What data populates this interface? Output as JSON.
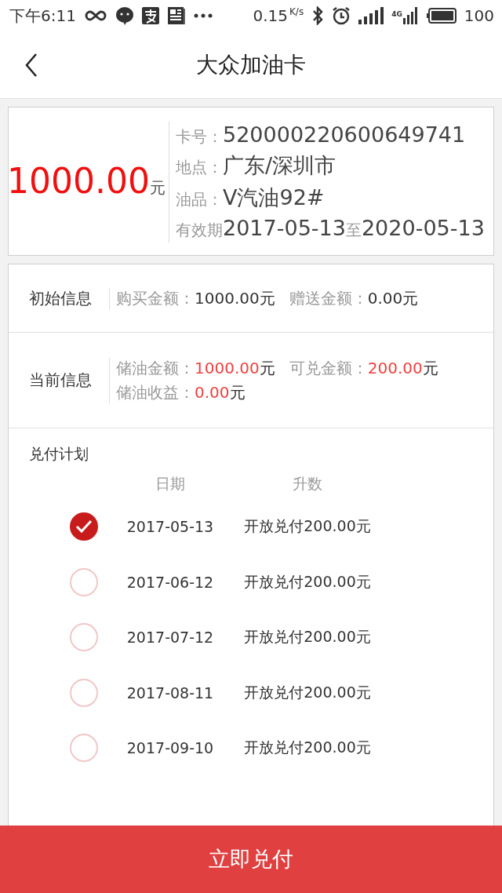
{
  "status_bar": {
    "time": "下午6:11",
    "speed": "0.15",
    "speed_unit": "K/s",
    "network_type": "4G",
    "battery": "100"
  },
  "header": {
    "title": "大众加油卡"
  },
  "card": {
    "amount": "1000.00",
    "unit": "元",
    "details": [
      {
        "label": "卡号：",
        "value": "520000220600649741"
      },
      {
        "label": "地点：",
        "value": "广东/深圳市"
      },
      {
        "label": "油品：",
        "value": "V汽油92#"
      },
      {
        "label": "有效期",
        "value": "2017-05-13",
        "separator": "至",
        "value_end": "2020-05-13"
      }
    ]
  },
  "info_sections": [
    {
      "title": "初始信息",
      "items": [
        {
          "label": "购买金额：",
          "value": "1000.00",
          "unit": "元",
          "highlight": false
        },
        {
          "label": "赠送金额：",
          "value": "0.00",
          "unit": "元",
          "highlight": false
        }
      ]
    },
    {
      "title": "当前信息",
      "items": [
        {
          "label": "储油金额：",
          "value": "1000.00",
          "unit": "元",
          "highlight": true
        },
        {
          "label": "可兑金额：",
          "value": "200.00",
          "unit": "元",
          "highlight": true
        },
        {
          "label": "储油收益：",
          "value": "0.00",
          "unit": "元",
          "highlight": true
        }
      ]
    }
  ],
  "plan": {
    "title": "兑付计划",
    "columns": [
      "日期",
      "升数"
    ],
    "rows": [
      {
        "date": "2017-05-13",
        "text": "开放兑付200.00元",
        "checked": true
      },
      {
        "date": "2017-06-12",
        "text": "开放兑付200.00元",
        "checked": false
      },
      {
        "date": "2017-07-12",
        "text": "开放兑付200.00元",
        "checked": false
      },
      {
        "date": "2017-08-11",
        "text": "开放兑付200.00元",
        "checked": false
      },
      {
        "date": "2017-09-10",
        "text": "开放兑付200.00元",
        "checked": false
      }
    ]
  },
  "action_button": "立即兑付"
}
